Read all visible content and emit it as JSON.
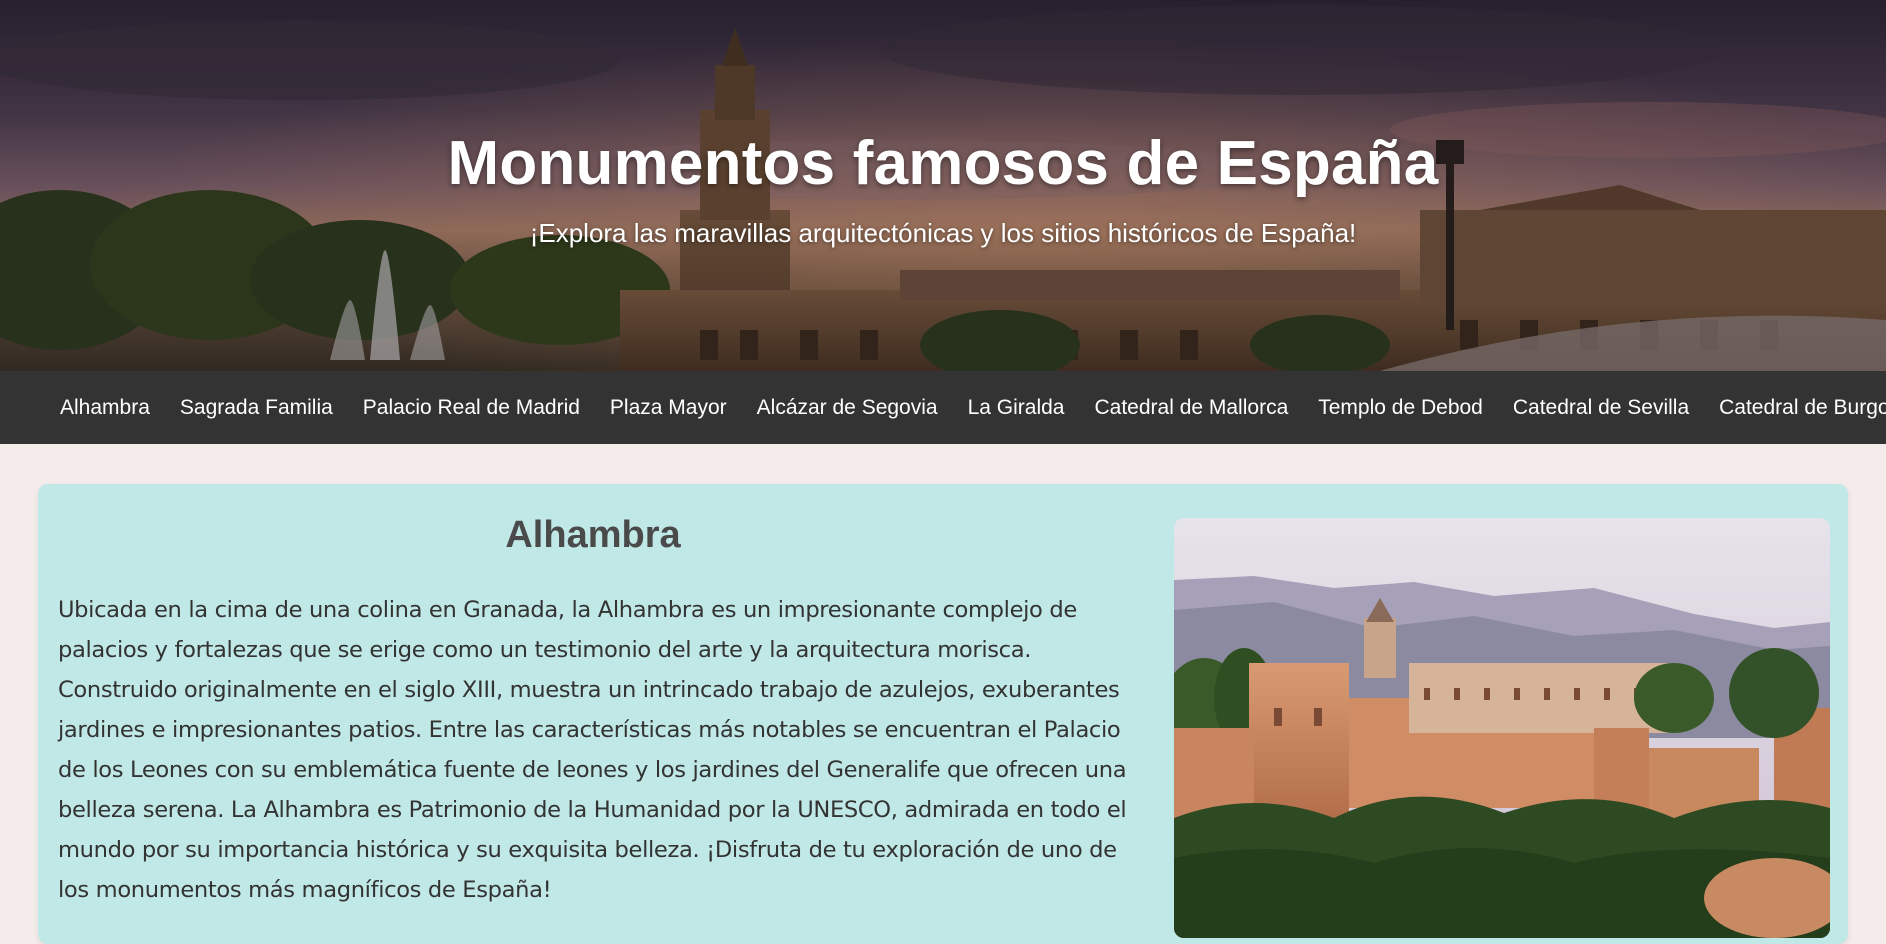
{
  "hero": {
    "title": "Monumentos famosos de España",
    "subtitle": "¡Explora las maravillas arquitectónicas y los sitios históricos de España!",
    "background_image": "Plaza de España (Sevilla) at dusk"
  },
  "nav": {
    "items": [
      "Alhambra",
      "Sagrada Familia",
      "Palacio Real de Madrid",
      "Plaza Mayor",
      "Alcázar de Segovia",
      "La Giralda",
      "Catedral de Mallorca",
      "Templo de Debod",
      "Catedral de Sevilla",
      "Catedral de Burgos"
    ]
  },
  "monument": {
    "title": "Alhambra",
    "description": "Ubicada en la cima de una colina en Granada, la Alhambra es un impresionante complejo de palacios y fortalezas que se erige como un testimonio del arte y la arquitectura morisca. Construido originalmente en el siglo XIII, muestra un intrincado trabajo de azulejos, exuberantes jardines e impresionantes patios. Entre las características más notables se encuentran el Palacio de los Leones con su emblemática fuente de leones y los jardines del Generalife que ofrecen una belleza serena. La Alhambra es Patrimonio de la Humanidad por la UNESCO, admirada en todo el mundo por su importancia histórica y su exquisita belleza. ¡Disfruta de tu exploración de uno de los monumentos más magníficos de España!",
    "image": "Alhambra fortress on a hilltop at sunset with Sierra Nevada mountains"
  },
  "colors": {
    "nav_background": "#333333",
    "page_background": "#f3eceb",
    "card_background": "#c0e8e6",
    "title_color": "#4a4a4a",
    "text_color": "#333333"
  }
}
